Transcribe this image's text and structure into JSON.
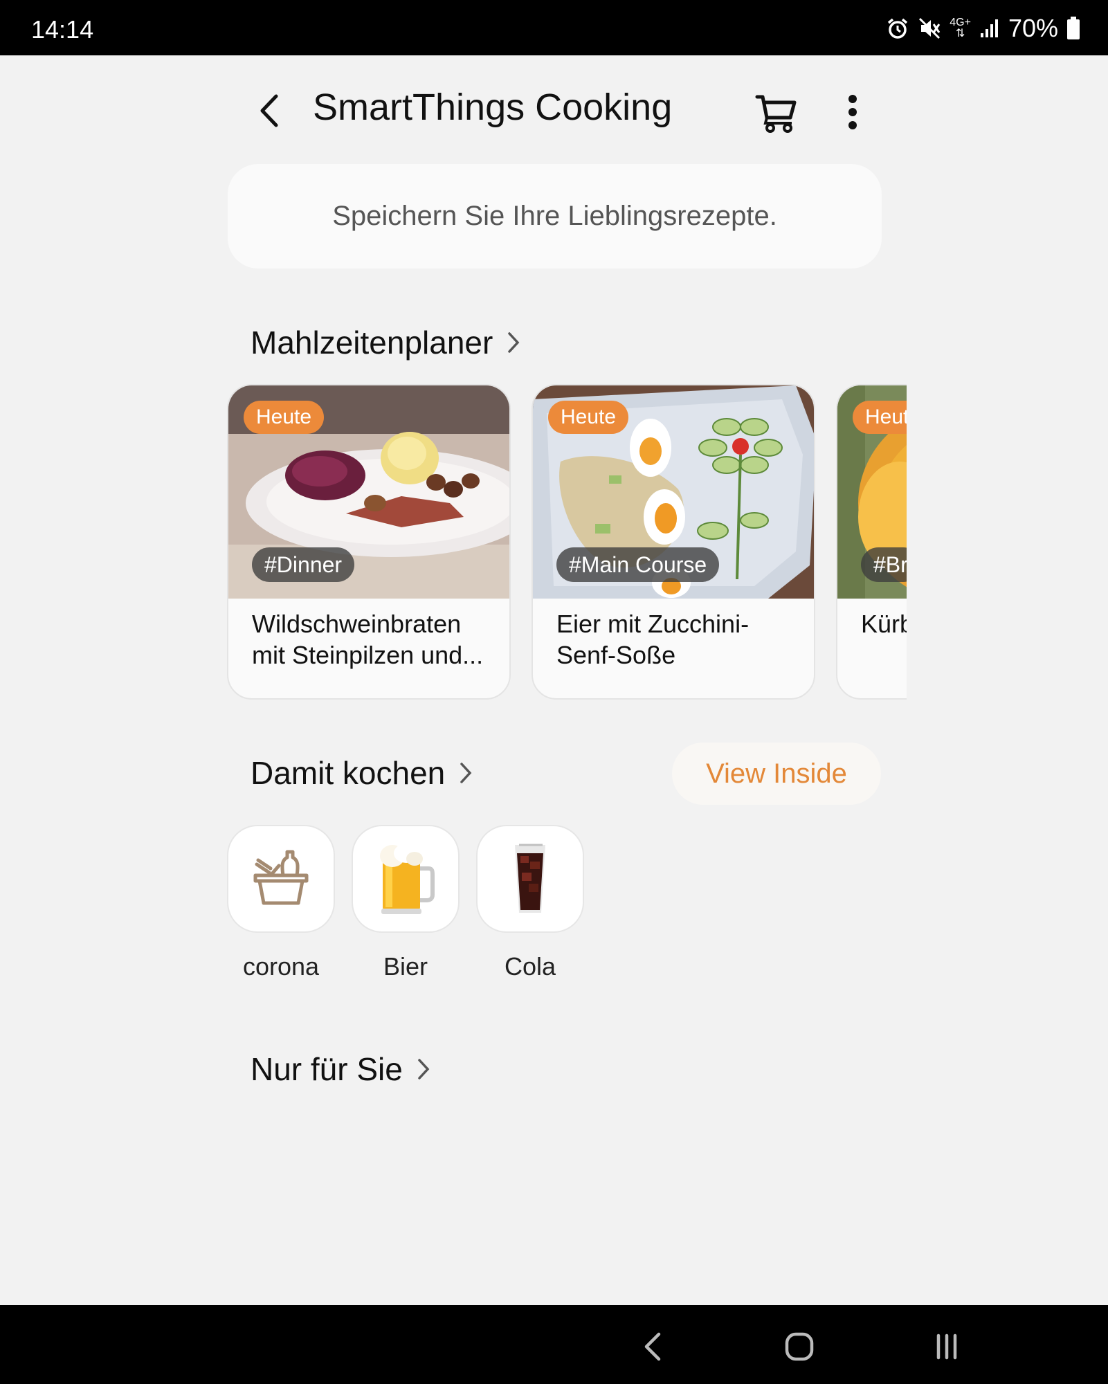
{
  "status": {
    "time": "14:14",
    "network": "4G+",
    "battery": "70%",
    "icons": [
      "alarm-icon",
      "mute-icon",
      "network-4g-icon",
      "signal-icon",
      "battery-icon"
    ]
  },
  "header": {
    "title": "SmartThings Cooking",
    "back_icon": "back-arrow-icon",
    "cart_icon": "cart-icon",
    "more_icon": "more-vertical-icon"
  },
  "banner": {
    "text": "Speichern Sie Ihre Lieblingsrezepte."
  },
  "meal_planner": {
    "title": "Mahlzeitenplaner",
    "cards": [
      {
        "badge": "Heute",
        "tag": "#Dinner",
        "title": "Wildschweinbraten mit Steinpilzen und..."
      },
      {
        "badge": "Heute",
        "tag": "#Main Course",
        "title": "Eier mit Zucchini-Senf-Soße"
      },
      {
        "badge": "Heute",
        "tag": "#Br",
        "title": "Kürb"
      }
    ]
  },
  "cook_with": {
    "title": "Damit kochen",
    "view_inside": "View Inside",
    "items": [
      {
        "label": "corona",
        "icon": "basket-icon"
      },
      {
        "label": "Bier",
        "icon": "beer-icon"
      },
      {
        "label": "Cola",
        "icon": "cola-icon"
      }
    ]
  },
  "for_you": {
    "title": "Nur für Sie"
  },
  "colors": {
    "accent": "#ec8a3a",
    "view_inside_text": "#e38838",
    "background": "#f2f2f2"
  }
}
